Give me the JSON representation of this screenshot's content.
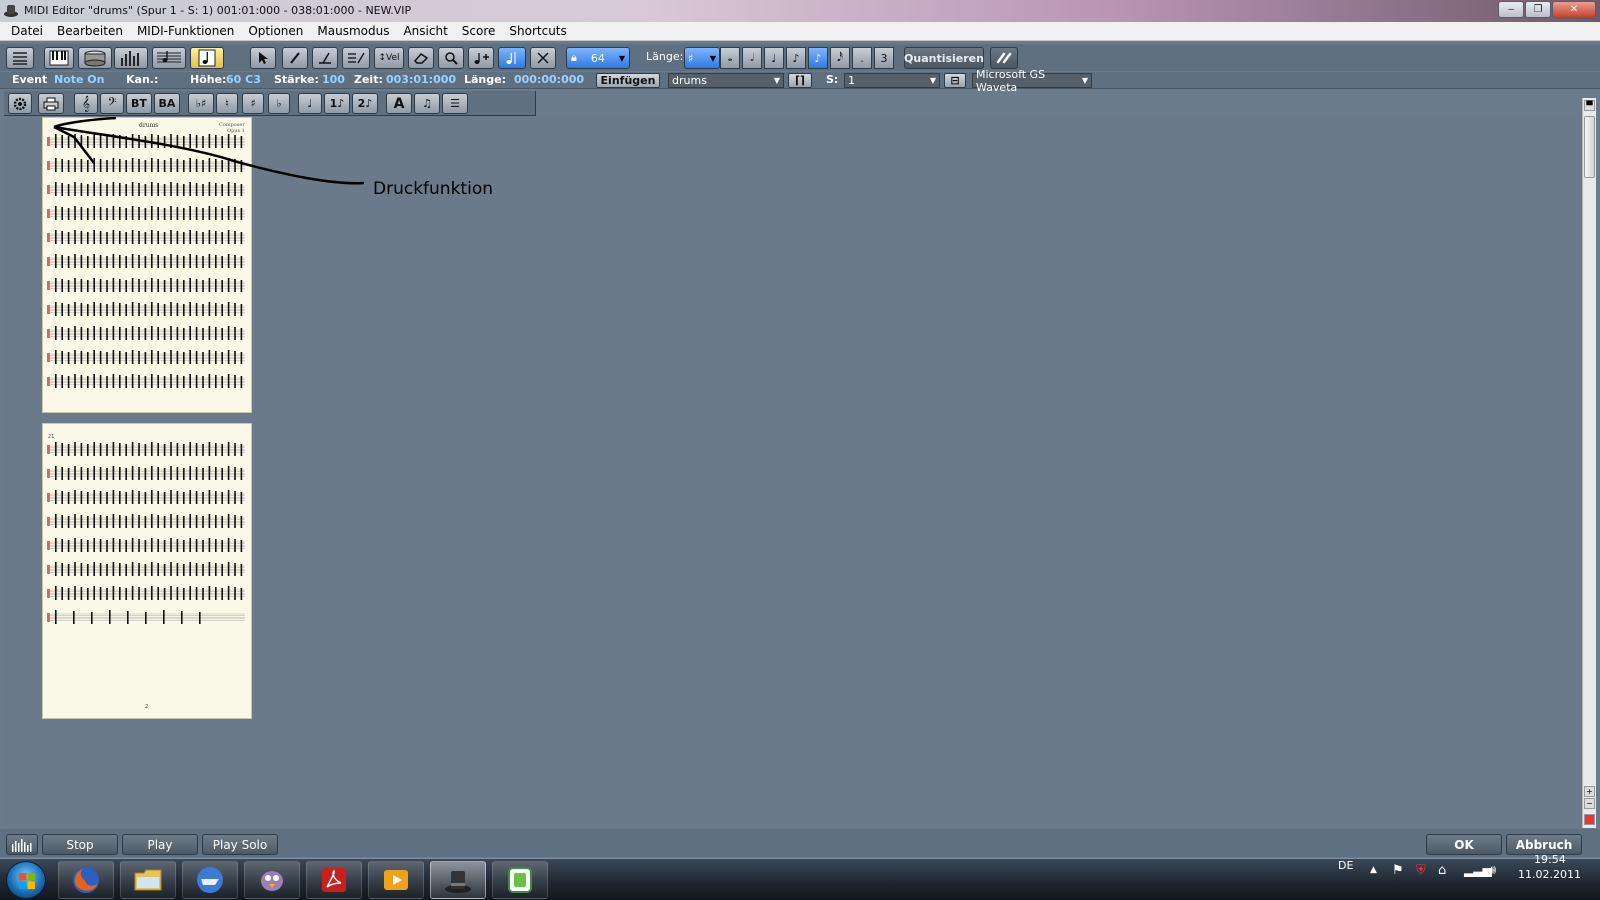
{
  "window": {
    "title": "MIDI Editor \"drums\"  (Spur 1 - S:  1) 001:01:000 - 038:01:000 - NEW.VIP",
    "minimize_label": "‒",
    "maximize_label": "❐",
    "close_label": "✕"
  },
  "menu": [
    "Datei",
    "Bearbeiten",
    "MIDI-Funktionen",
    "Optionen",
    "Mausmodus",
    "Ansicht",
    "Score",
    "Shortcuts"
  ],
  "toolbar": {
    "velocity_label": "Vel",
    "grid_value": "64",
    "length_label": "Länge:",
    "triplet_label": "3",
    "quantize_label": "Quantisieren"
  },
  "eventbar": {
    "event_label": "Event",
    "event_type": "Note On",
    "channel_label": "Kan.:",
    "pitch_label": "Höhe:",
    "pitch_value": "60 C3",
    "velocity_label": "Stärke:",
    "velocity_value": "100",
    "time_label": "Zeit:",
    "time_value": "003:01:000",
    "length_label": "Länge:",
    "length_value": "000:00:000",
    "insert_label": "Einfügen",
    "track_select": "drums",
    "s_label": "S:",
    "s_value": "1",
    "device_select": "Microsoft GS Waveta"
  },
  "scorebar": {
    "bass_treble_label": "BT",
    "treble_bass_label": "BA",
    "text_label": "A",
    "voice1_label": "1",
    "voice2_label": "2"
  },
  "score": {
    "page1_title": "drums",
    "page1_composer": "Composer",
    "page1_opus": "Opus 1",
    "page2_bar_label": "21",
    "page2_number": "2",
    "annotation": "Druckfunktion"
  },
  "bottom": {
    "stop": "Stop",
    "play": "Play",
    "play_solo": "Play Solo",
    "ok": "OK",
    "cancel": "Abbruch"
  },
  "taskbar": {
    "language": "DE",
    "time": "19:54",
    "date": "11.02.2011"
  }
}
